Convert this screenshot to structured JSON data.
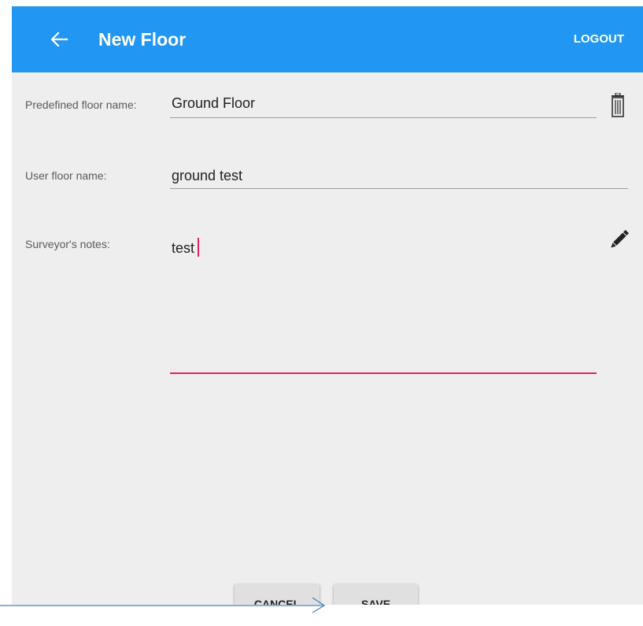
{
  "appbar": {
    "back_icon": "arrow-back-icon",
    "title": "New Floor",
    "logout_label": "LOGOUT",
    "background_color": "#2196f3"
  },
  "form": {
    "predefined_floor_name": {
      "label": "Predefined floor name:",
      "value": "Ground Floor",
      "action_icon": "trash-icon"
    },
    "user_floor_name": {
      "label": "User floor name:",
      "value": "ground test"
    },
    "surveyors_notes": {
      "label": "Surveyor's notes:",
      "value": "test",
      "action_icon": "pencil-icon",
      "focused": true,
      "focus_color": "#e91e63"
    }
  },
  "actions": {
    "cancel_label": "CANCEL",
    "save_label": "SAVE"
  },
  "annotation": {
    "arrow_color": "#4a7cc4",
    "points_to": "save-button"
  }
}
